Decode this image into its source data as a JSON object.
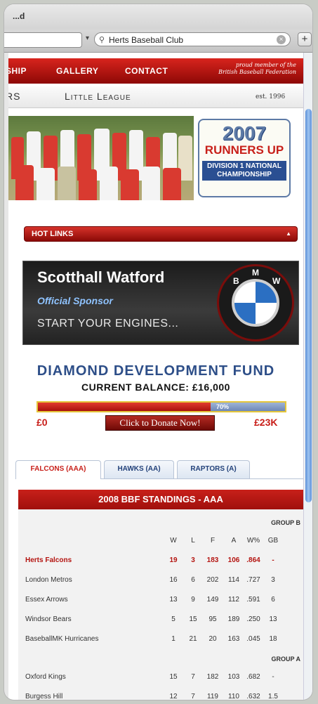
{
  "browser": {
    "window_title": "...d",
    "search_text": "Herts Baseball Club",
    "search_icon": "magnifier-icon",
    "add_label": "+"
  },
  "nav": {
    "items": [
      "SHIP",
      "GALLERY",
      "CONTACT"
    ],
    "member_line1": "proud member of the",
    "member_line2": "British Baseball Federation"
  },
  "subnav": {
    "left": "RS",
    "center": "Little League",
    "est": "est. 1996"
  },
  "badge": {
    "year": "2007",
    "line1": "RUNNERS UP",
    "line2": "DIVISION 1 NATIONAL",
    "line3": "CHAMPIONSHIP"
  },
  "hotlinks": {
    "label": "HOT LINKS"
  },
  "sponsor": {
    "name": "Scotthall Watford",
    "role": "Official Sponsor",
    "tagline": "START YOUR ENGINES...",
    "logo_letters": [
      "B",
      "M",
      "W"
    ]
  },
  "fund": {
    "title": "DIAMOND DEVELOPMENT FUND",
    "balance": "CURRENT BALANCE: £16,000",
    "progress_percent": 70,
    "progress_label": "70%",
    "min_label": "£0",
    "max_label": "£23K",
    "donate_label": "Click to Donate Now!"
  },
  "tabs": [
    {
      "label": "FALCONS (AAA)",
      "active": true
    },
    {
      "label": "HAWKS (AA)",
      "active": false
    },
    {
      "label": "RAPTORS (A)",
      "active": false
    }
  ],
  "standings": {
    "title": "2008 BBF STANDINGS - AAA",
    "columns": [
      "W",
      "L",
      "F",
      "A",
      "W%",
      "GB"
    ],
    "group_b_label": "GROUP B",
    "group_a_label": "GROUP A",
    "group_b": [
      {
        "team": "Herts Falcons",
        "values": [
          "19",
          "3",
          "183",
          "106",
          ".864",
          "-"
        ],
        "highlight": true
      },
      {
        "team": "London Metros",
        "values": [
          "16",
          "6",
          "202",
          "114",
          ".727",
          "3"
        ]
      },
      {
        "team": "Essex Arrows",
        "values": [
          "13",
          "9",
          "149",
          "112",
          ".591",
          "6"
        ]
      },
      {
        "team": "Windsor Bears",
        "values": [
          "5",
          "15",
          "95",
          "189",
          ".250",
          "13"
        ]
      },
      {
        "team": "BaseballMK Hurricanes",
        "values": [
          "1",
          "21",
          "20",
          "163",
          ".045",
          "18"
        ]
      }
    ],
    "group_a": [
      {
        "team": "Oxford Kings",
        "values": [
          "15",
          "7",
          "182",
          "103",
          ".682",
          "-"
        ]
      },
      {
        "team": "Burgess Hill",
        "values": [
          "12",
          "7",
          "119",
          "110",
          ".632",
          "1.5"
        ]
      }
    ]
  }
}
